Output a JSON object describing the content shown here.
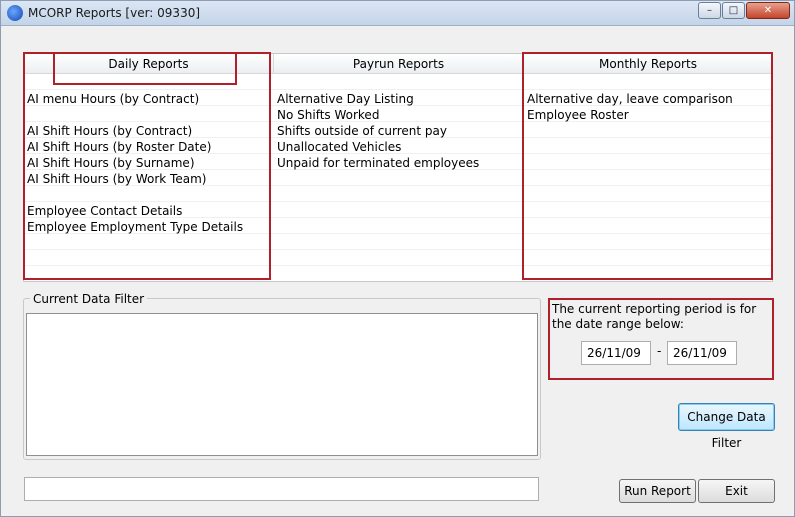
{
  "window": {
    "title": "MCORP Reports [ver: 09330]",
    "controls": {
      "minimize": "–",
      "maximize": "□",
      "close": "✕"
    }
  },
  "reports": {
    "columns": [
      {
        "header": "Daily Reports"
      },
      {
        "header": "Payrun Reports"
      },
      {
        "header": "Monthly Reports"
      }
    ],
    "daily": [
      "AI menu Hours (by Contract)",
      "",
      "AI Shift Hours (by Contract)",
      "AI Shift Hours (by Roster Date)",
      "AI Shift Hours (by Surname)",
      "AI Shift Hours (by Work Team)",
      "",
      "Employee Contact Details",
      "Employee Employment Type Details"
    ],
    "payrun": [
      "Alternative Day Listing",
      "No Shifts Worked",
      "Shifts outside of current pay",
      "Unallocated Vehicles",
      "Unpaid for terminated employees"
    ],
    "monthly": [
      "Alternative day, leave comparison",
      "Employee Roster"
    ]
  },
  "filter": {
    "label": "Current Data Filter",
    "value": ""
  },
  "period": {
    "text": "The current reporting period is for the date range below:",
    "from": "26/11/09",
    "separator": "-",
    "to": "26/11/09"
  },
  "buttons": {
    "change_filter": "Change Data Filter",
    "run_report": "Run Report",
    "exit": "Exit"
  },
  "status": ""
}
